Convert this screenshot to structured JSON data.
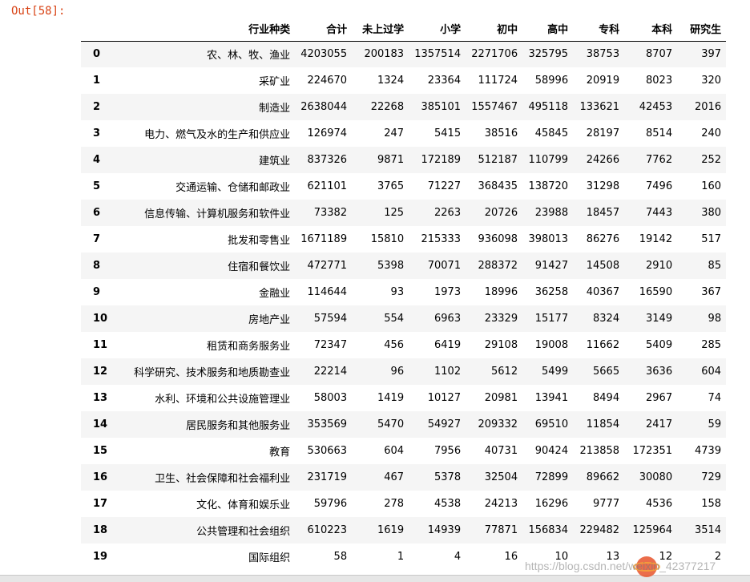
{
  "prompt": "Out[58]:",
  "columns": [
    "行业种类",
    "合计",
    "未上过学",
    "小学",
    "初中",
    "高中",
    "专科",
    "本科",
    "研究生"
  ],
  "rows": [
    {
      "index": "0",
      "cells": [
        "农、林、牧、渔业",
        "4203055",
        "200183",
        "1357514",
        "2271706",
        "325795",
        "38753",
        "8707",
        "397"
      ]
    },
    {
      "index": "1",
      "cells": [
        "采矿业",
        "224670",
        "1324",
        "23364",
        "111724",
        "58996",
        "20919",
        "8023",
        "320"
      ]
    },
    {
      "index": "2",
      "cells": [
        "制造业",
        "2638044",
        "22268",
        "385101",
        "1557467",
        "495118",
        "133621",
        "42453",
        "2016"
      ]
    },
    {
      "index": "3",
      "cells": [
        "电力、燃气及水的生产和供应业",
        "126974",
        "247",
        "5415",
        "38516",
        "45845",
        "28197",
        "8514",
        "240"
      ]
    },
    {
      "index": "4",
      "cells": [
        "建筑业",
        "837326",
        "9871",
        "172189",
        "512187",
        "110799",
        "24266",
        "7762",
        "252"
      ]
    },
    {
      "index": "5",
      "cells": [
        "交通运输、仓储和邮政业",
        "621101",
        "3765",
        "71227",
        "368435",
        "138720",
        "31298",
        "7496",
        "160"
      ]
    },
    {
      "index": "6",
      "cells": [
        "信息传输、计算机服务和软件业",
        "73382",
        "125",
        "2263",
        "20726",
        "23988",
        "18457",
        "7443",
        "380"
      ]
    },
    {
      "index": "7",
      "cells": [
        "批发和零售业",
        "1671189",
        "15810",
        "215333",
        "936098",
        "398013",
        "86276",
        "19142",
        "517"
      ]
    },
    {
      "index": "8",
      "cells": [
        "住宿和餐饮业",
        "472771",
        "5398",
        "70071",
        "288372",
        "91427",
        "14508",
        "2910",
        "85"
      ]
    },
    {
      "index": "9",
      "cells": [
        "金融业",
        "114644",
        "93",
        "1973",
        "18996",
        "36258",
        "40367",
        "16590",
        "367"
      ]
    },
    {
      "index": "10",
      "cells": [
        "房地产业",
        "57594",
        "554",
        "6963",
        "23329",
        "15177",
        "8324",
        "3149",
        "98"
      ]
    },
    {
      "index": "11",
      "cells": [
        "租赁和商务服务业",
        "72347",
        "456",
        "6419",
        "29108",
        "19008",
        "11662",
        "5409",
        "285"
      ]
    },
    {
      "index": "12",
      "cells": [
        "科学研究、技术服务和地质勘查业",
        "22214",
        "96",
        "1102",
        "5612",
        "5499",
        "5665",
        "3636",
        "604"
      ]
    },
    {
      "index": "13",
      "cells": [
        "水利、环境和公共设施管理业",
        "58003",
        "1419",
        "10127",
        "20981",
        "13941",
        "8494",
        "2967",
        "74"
      ]
    },
    {
      "index": "14",
      "cells": [
        "居民服务和其他服务业",
        "353569",
        "5470",
        "54927",
        "209332",
        "69510",
        "11854",
        "2417",
        "59"
      ]
    },
    {
      "index": "15",
      "cells": [
        "教育",
        "530663",
        "604",
        "7956",
        "40731",
        "90424",
        "213858",
        "172351",
        "4739"
      ]
    },
    {
      "index": "16",
      "cells": [
        "卫生、社会保障和社会福利业",
        "231719",
        "467",
        "5378",
        "32504",
        "72899",
        "89662",
        "30080",
        "729"
      ]
    },
    {
      "index": "17",
      "cells": [
        "文化、体育和娱乐业",
        "59796",
        "278",
        "4538",
        "24213",
        "16296",
        "9777",
        "4536",
        "158"
      ]
    },
    {
      "index": "18",
      "cells": [
        "公共管理和社会组织",
        "610223",
        "1619",
        "14939",
        "77871",
        "156834",
        "229482",
        "125964",
        "3514"
      ]
    },
    {
      "index": "19",
      "cells": [
        "国际组织",
        "58",
        "1",
        "4",
        "16",
        "10",
        "13",
        "12",
        "2"
      ]
    }
  ],
  "watermark": "https://blog.csdn.net/weixin_42377217",
  "colors": {
    "prompt": "#d84315",
    "stripe": "#f5f5f5"
  }
}
